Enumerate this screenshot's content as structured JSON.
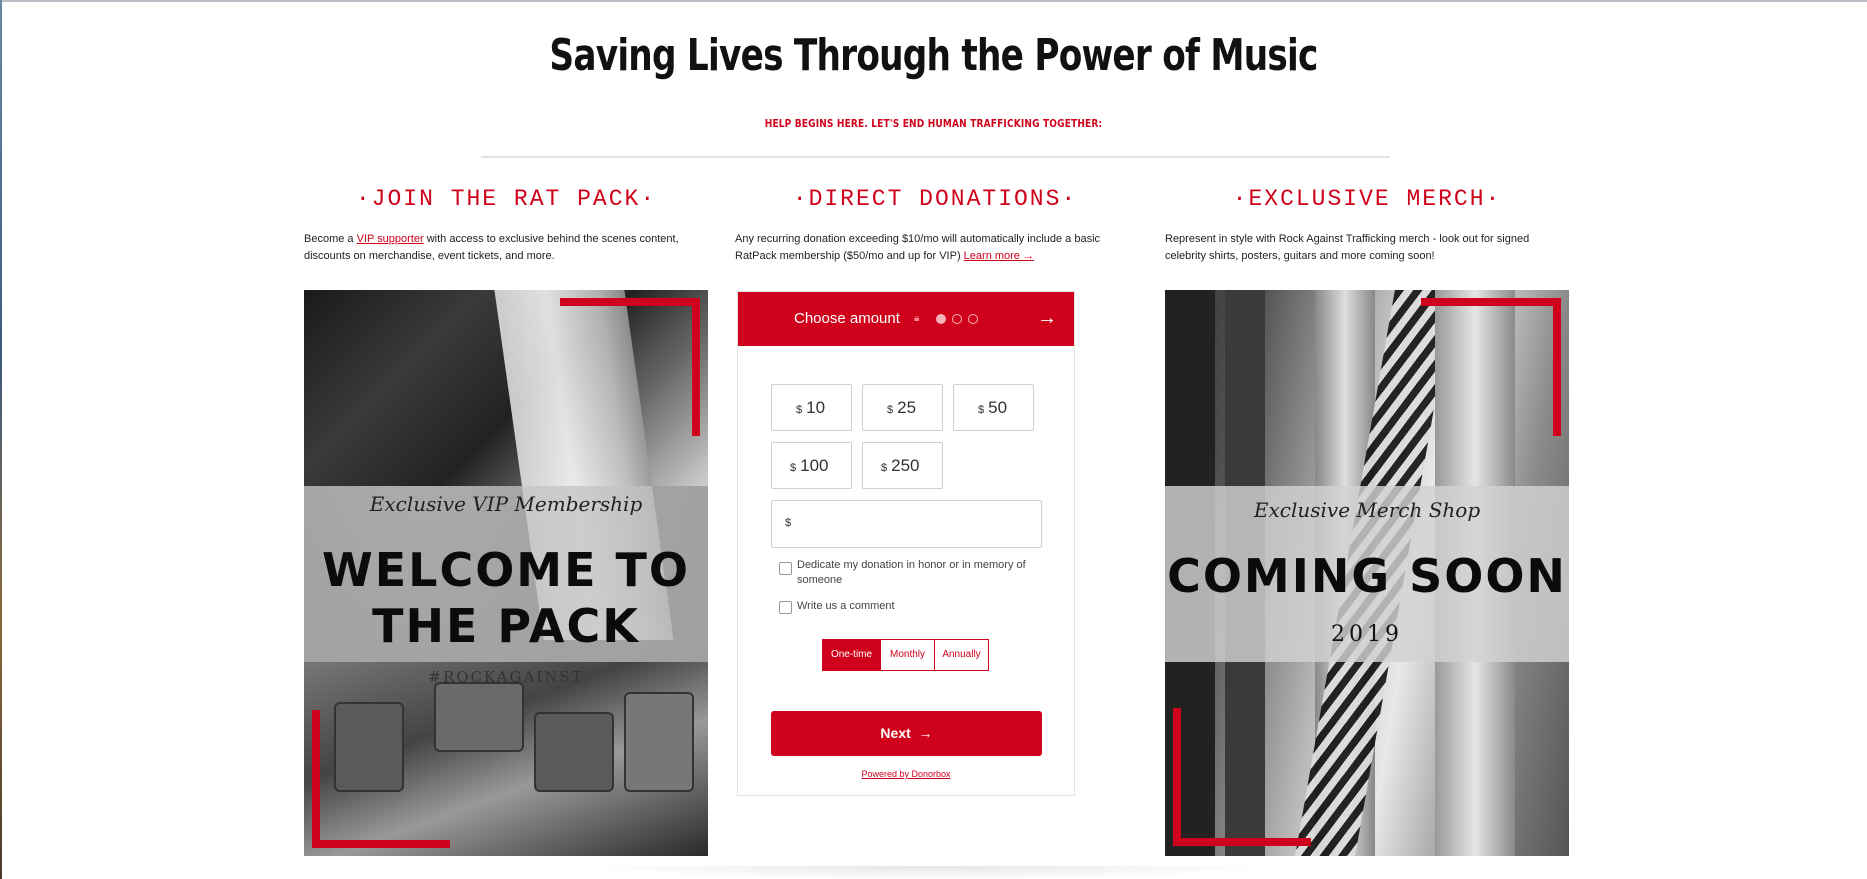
{
  "page": {
    "title": "Saving Lives Through the Power of Music",
    "subtitle": "HELP BEGINS HERE. LET'S END HUMAN TRAFFICKING TOGETHER:"
  },
  "columns": {
    "rat_pack": {
      "heading": "·JOIN THE RAT PACK·",
      "text_before": "Become a ",
      "link": "VIP supporter",
      "text_after": " with access to exclusive behind the scenes content, discounts on merchandise, event tickets, and more.",
      "card": {
        "subtitle": "Exclusive VIP Membership",
        "headline_line1": "WELCOME TO",
        "headline_line2": "THE PACK",
        "hashtag": "#ROCKAGAINST"
      }
    },
    "donations": {
      "heading": "·DIRECT DONATIONS·",
      "text": "Any recurring donation exceeding $10/mo will automatically include a basic RatPack membership ($50/mo and up for VIP) ",
      "link": "Learn more →"
    },
    "merch": {
      "heading": "·EXCLUSIVE MERCH·",
      "text": "Represent in style with Rock Against Trafficking merch - look out for signed celebrity shirts, posters, guitars and more coming soon!",
      "card": {
        "subtitle": "Exclusive Merch Shop",
        "headline": "COMING SOON",
        "year": "2019"
      }
    }
  },
  "donation_widget": {
    "header_title": "Choose amount",
    "lock_icon": "lock-icon",
    "steps": 3,
    "active_step": 1,
    "currency": "$",
    "amounts": [
      "10",
      "25",
      "50",
      "100",
      "250"
    ],
    "custom_amount": "",
    "checkbox_dedicate": "Dedicate my donation in honor or in memory of someone",
    "checkbox_comment": "Write us a comment",
    "frequency": [
      "One-time",
      "Monthly",
      "Annually"
    ],
    "selected_frequency": "One-time",
    "next_label": "Next",
    "powered_by": "Powered by Donorbox"
  },
  "colors": {
    "accent": "#d0021b"
  }
}
